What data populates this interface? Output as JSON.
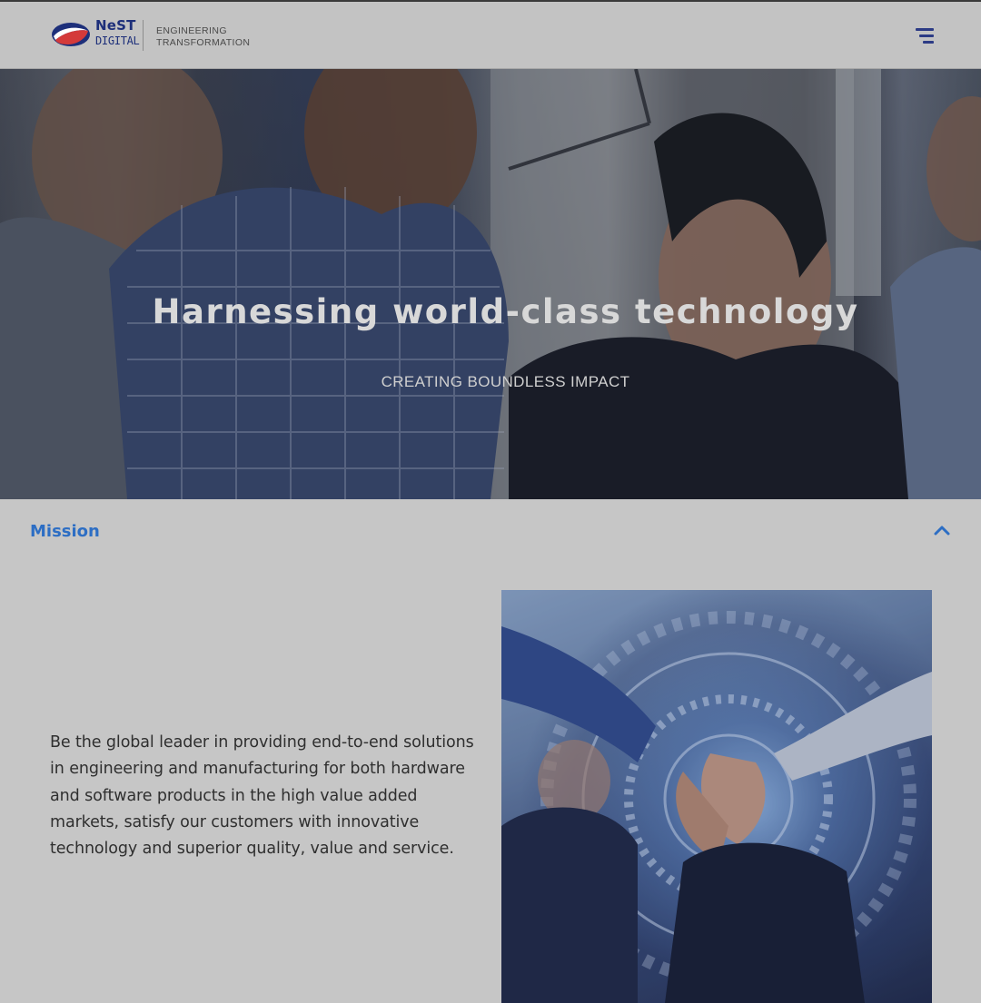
{
  "header": {
    "logo_nest": "NeST",
    "logo_digital": "DIGITAL",
    "tagline_line1": "ENGINEERING",
    "tagline_line2": "TRANSFORMATION",
    "menu_icon": "hamburger-menu-icon"
  },
  "hero": {
    "title": "Harnessing world-class technology",
    "subtitle": "CREATING BOUNDLESS IMPACT"
  },
  "mission": {
    "heading": "Mission",
    "toggle_icon": "chevron-up-icon",
    "body": "Be the global leader in providing end-to-end solutions in engineering and manufacturing for both hardware and software products in the high value added markets, satisfy our customers with innovative technology and superior quality, value and service."
  },
  "colors": {
    "brand_blue": "#1d2f7a",
    "brand_red": "#d43a3a",
    "accent_link": "#2d6ec4",
    "page_bg": "#c6c6c6"
  }
}
